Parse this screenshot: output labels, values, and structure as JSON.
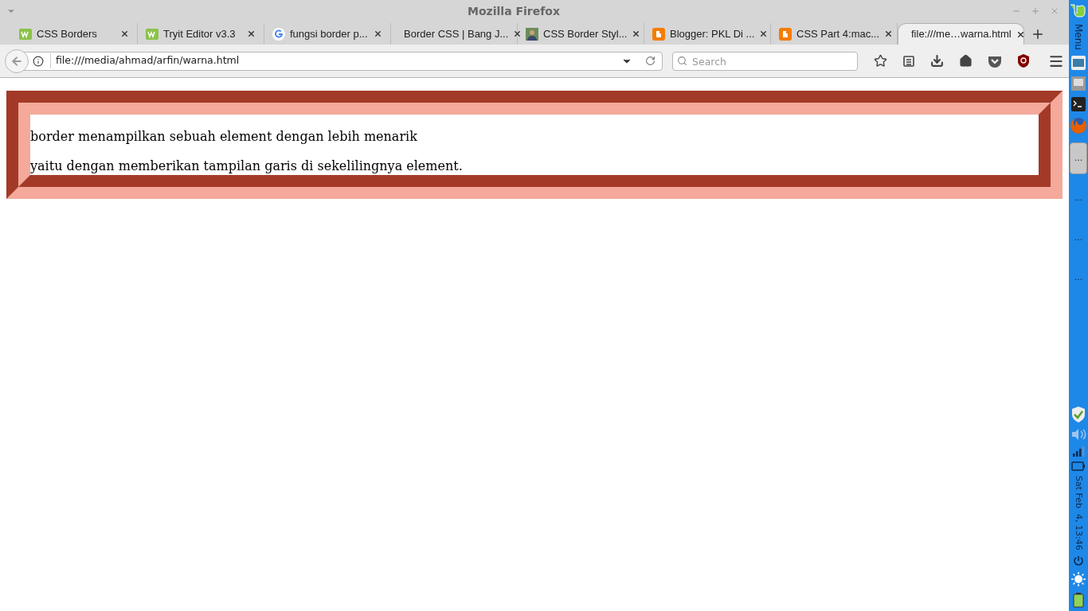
{
  "window": {
    "title": "Mozilla Firefox"
  },
  "tabs": [
    {
      "label": "CSS Borders",
      "kind": "w3",
      "selected": false
    },
    {
      "label": "Tryit Editor v3.3",
      "kind": "w3",
      "selected": false
    },
    {
      "label": "fungsi border p...",
      "kind": "google",
      "selected": false
    },
    {
      "label": "Border CSS | Bang J...",
      "kind": "plain",
      "selected": false
    },
    {
      "label": "CSS Border Styl...",
      "kind": "avatar",
      "selected": false
    },
    {
      "label": "Blogger: PKL Di ...",
      "kind": "blogger",
      "selected": false
    },
    {
      "label": "CSS Part 4:mac...",
      "kind": "blogger",
      "selected": false
    },
    {
      "label": "file:///me…warna.html",
      "kind": "plain",
      "selected": true
    }
  ],
  "address_bar": {
    "value": "file:///media/ahmad/arfin/warna.html"
  },
  "search": {
    "placeholder": "Search"
  },
  "page": {
    "lines": [
      "border menampilkan sebuah element dengan lebih menarik",
      "yaitu dengan memberikan tampilan garis di sekelilingnya element."
    ]
  },
  "panel": {
    "menu_label": "Menu",
    "window_buttons": [
      {
        "label": "...",
        "selected": true
      },
      {
        "label": "...",
        "selected": false
      },
      {
        "label": "...",
        "selected": false
      },
      {
        "label": "...",
        "selected": false
      }
    ],
    "clock": "Sat Feb  4, 13:46"
  }
}
